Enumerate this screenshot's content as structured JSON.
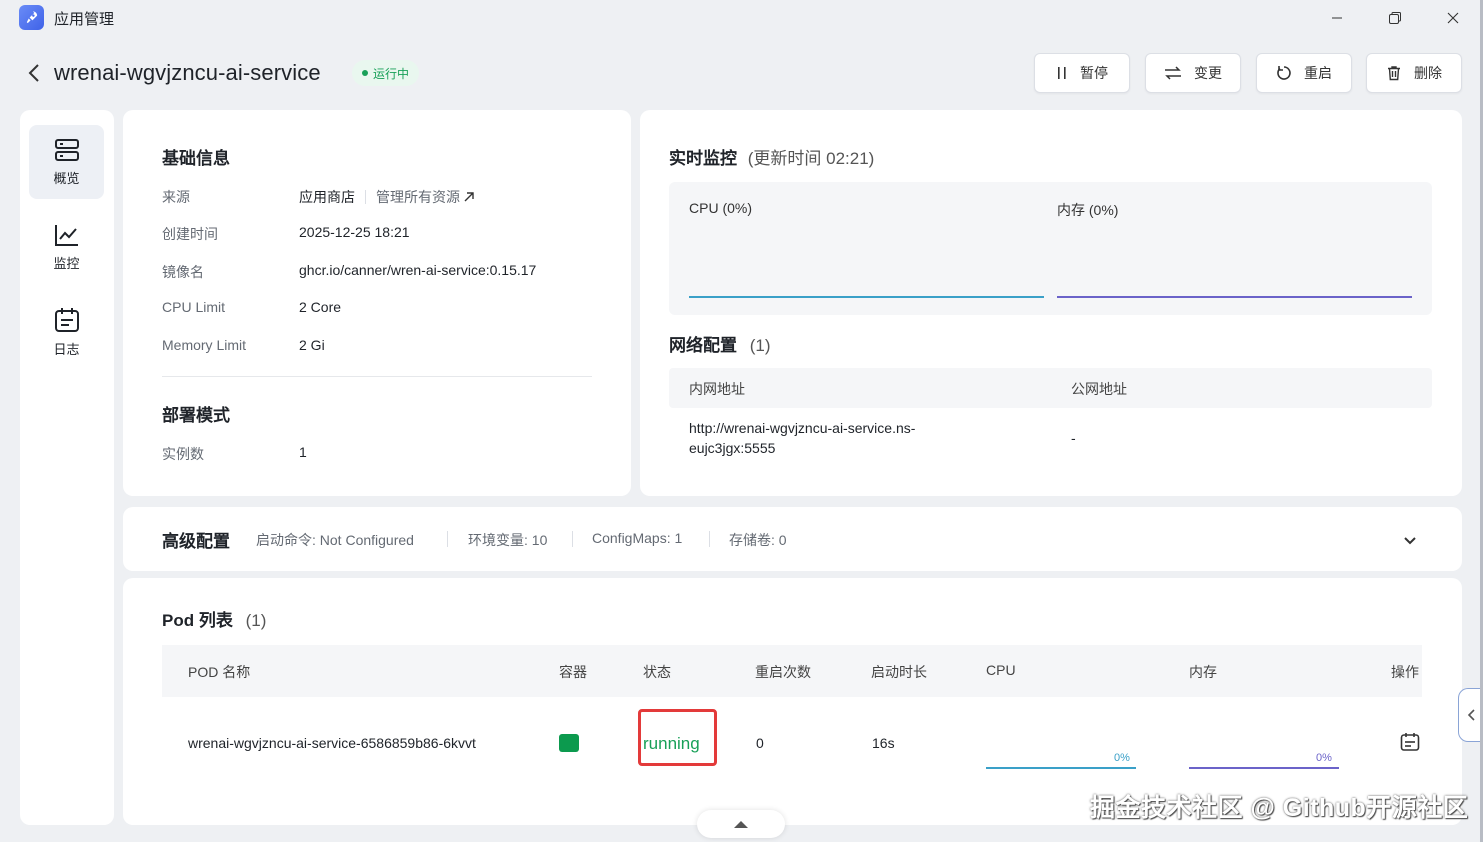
{
  "window": {
    "title": "应用管理"
  },
  "header": {
    "app_name": "wrenai-wgvjzncu-ai-service",
    "status": "运行中",
    "actions": {
      "pause": "暂停",
      "change": "变更",
      "restart": "重启",
      "delete": "删除"
    }
  },
  "sidebar": {
    "items": [
      {
        "label": "概览",
        "icon": "server-icon",
        "active": true
      },
      {
        "label": "监控",
        "icon": "line-chart-icon",
        "active": false
      },
      {
        "label": "日志",
        "icon": "calendar-log-icon",
        "active": false
      }
    ]
  },
  "basic": {
    "title": "基础信息",
    "source_label": "来源",
    "source_value": "应用商店",
    "source_link": "管理所有资源",
    "created_label": "创建时间",
    "created_value": "2025-12-25 18:21",
    "image_label": "镜像名",
    "image_value": "ghcr.io/canner/wren-ai-service:0.15.17",
    "cpu_label": "CPU Limit",
    "cpu_value": "2 Core",
    "mem_label": "Memory Limit",
    "mem_value": "2 Gi",
    "deploy_title": "部署模式",
    "replica_label": "实例数",
    "replica_value": "1"
  },
  "monitor": {
    "title": "实时监控",
    "updated": "(更新时间  02:21)",
    "cpu_label": "CPU  (0%)",
    "mem_label": "内存  (0%)",
    "cpu_color": "#3aa0c8",
    "mem_color": "#6b63c9"
  },
  "network": {
    "title": "网络配置",
    "count": "(1)",
    "col_internal": "内网地址",
    "col_public": "公网地址",
    "internal_line1": "http://wrenai-wgvjzncu-ai-service.ns-",
    "internal_line2": "eujc3jgx:5555",
    "public": "-"
  },
  "advanced": {
    "title": "高级配置",
    "startup": "启动命令: Not Configured",
    "env": "环境变量: 10",
    "configmaps": "ConfigMaps: 1",
    "volumes": "存储卷: 0"
  },
  "pods": {
    "title": "Pod 列表",
    "count": "(1)",
    "columns": [
      "POD 名称",
      "容器",
      "状态",
      "重启次数",
      "启动时长",
      "CPU",
      "内存",
      "操作"
    ],
    "rows": [
      {
        "name": "wrenai-wgvjzncu-ai-service-6586859b86-6kvvt",
        "status": "running",
        "restarts": "0",
        "uptime": "16s",
        "cpu": "0%",
        "mem": "0%"
      }
    ]
  },
  "watermark": "掘金技术社区 @ Github开源社区"
}
